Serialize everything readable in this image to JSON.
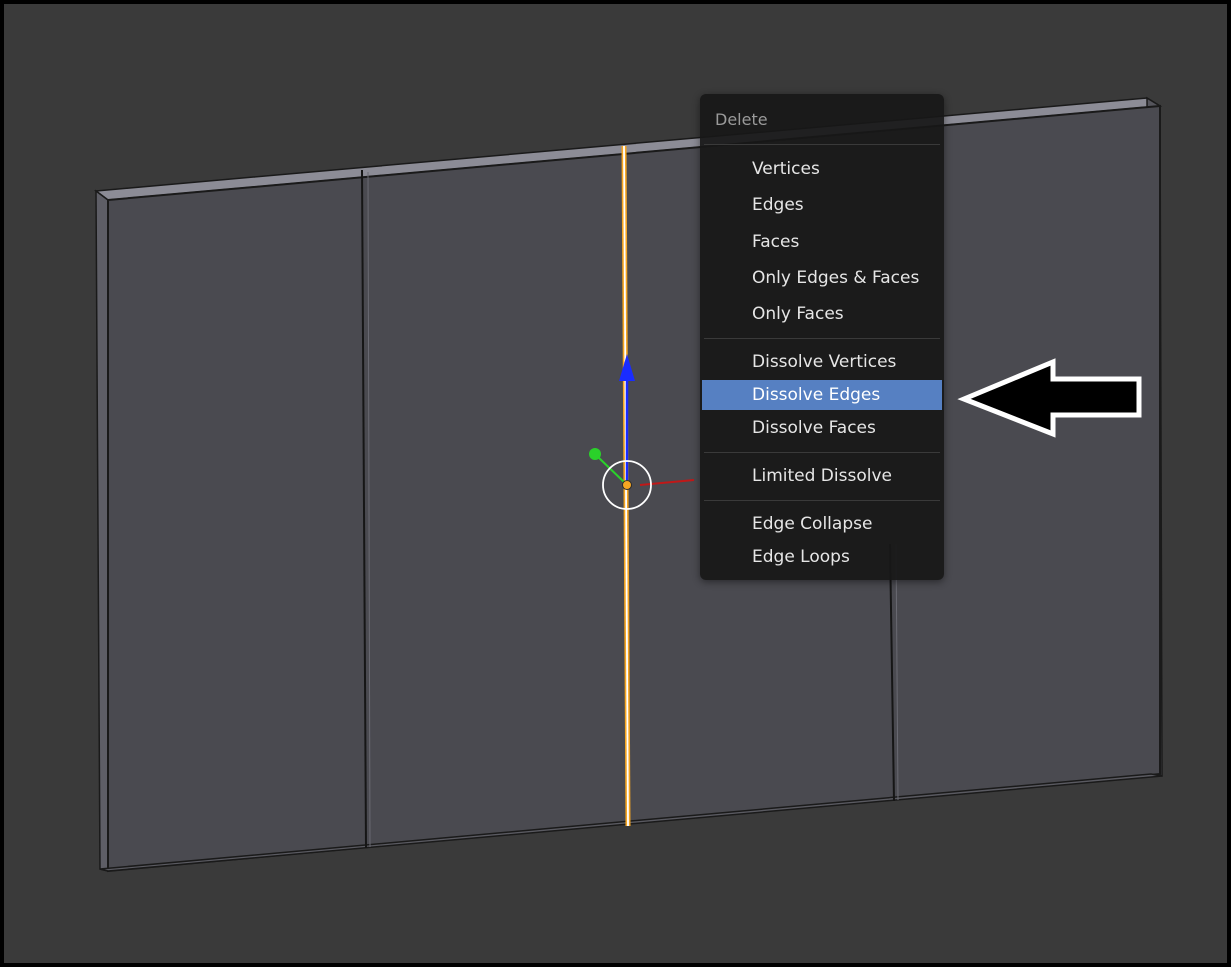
{
  "viewport": {
    "background": "#3a3a3a",
    "mesh_color": "#4a4a50",
    "selected_edge_color": "#f5a623",
    "gizmo": {
      "z_color": "#1a2cff",
      "y_color": "#2ad12a",
      "x_color": "#c01818"
    }
  },
  "delete_menu": {
    "title": "Delete",
    "items": [
      {
        "label": "Vertices"
      },
      {
        "label": "Edges"
      },
      {
        "label": "Faces"
      },
      {
        "label": "Only Edges & Faces"
      },
      {
        "label": "Only Faces"
      },
      {
        "label": "Dissolve Vertices"
      },
      {
        "label": "Dissolve Edges",
        "highlighted": true
      },
      {
        "label": "Dissolve Faces"
      },
      {
        "label": "Limited Dissolve"
      },
      {
        "label": "Edge Collapse"
      },
      {
        "label": "Edge Loops"
      }
    ]
  },
  "annotation": {
    "icon": "left-arrow-icon",
    "fill": "#000000",
    "outline": "#ffffff"
  }
}
